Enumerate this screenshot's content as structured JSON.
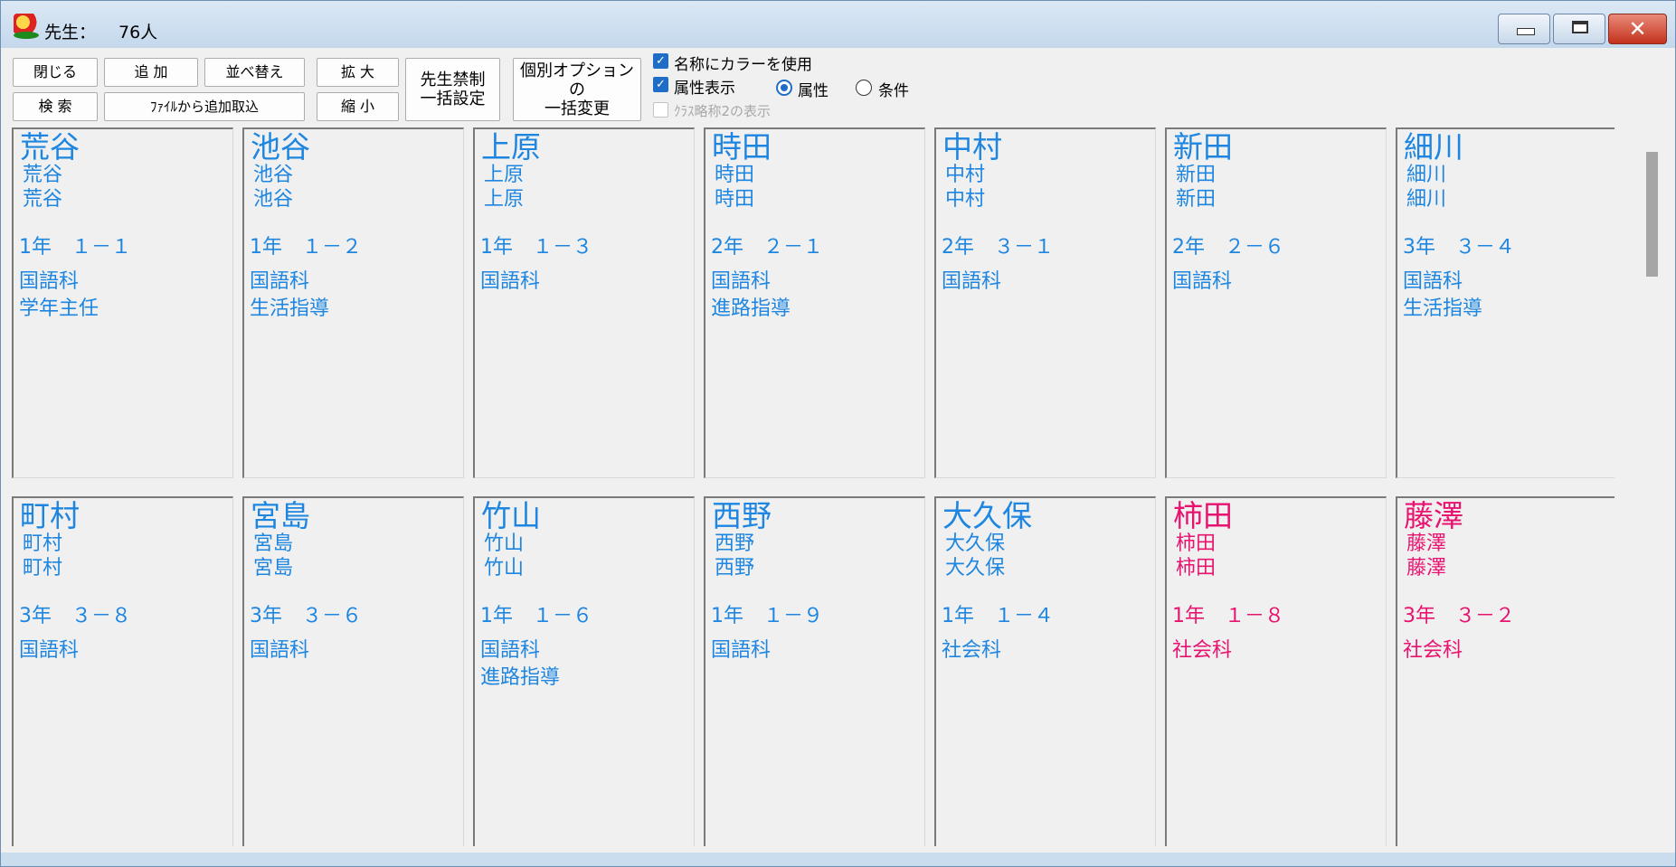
{
  "window": {
    "title_label": "先生：",
    "title_count": "76人",
    "minimize_glyph": "",
    "maximize_glyph": "",
    "close_glyph": "✕"
  },
  "toolbar": {
    "close": "閉じる",
    "add": "追 加",
    "sort": "並べ替え",
    "zoom_in": "拡 大",
    "search": "検 索",
    "import_file": "ﾌｧｲﾙから追加取込",
    "zoom_out": "縮 小",
    "teacher_ban_line1": "先生禁制",
    "teacher_ban_line2": "一括設定",
    "individual_opt_line1": "個別オプションの",
    "individual_opt_line2": "一括変更"
  },
  "options": {
    "use_color_label": "名称にカラーを使用",
    "use_color_checked": true,
    "show_attr_label": "属性表示",
    "show_attr_checked": true,
    "class_abbr_label": "ｸﾗｽ略称2の表示",
    "class_abbr_checked": false,
    "radio_attr_label": "属性",
    "radio_cond_label": "条件",
    "radio_selected": "属性"
  },
  "cards": [
    {
      "name": "荒谷",
      "sub1": "荒谷",
      "sub2": "荒谷",
      "grade": "1年　１－１",
      "attr1": "国語科",
      "attr2": "学年主任",
      "color": "blue"
    },
    {
      "name": "池谷",
      "sub1": "池谷",
      "sub2": "池谷",
      "grade": "1年　１－２",
      "attr1": "国語科",
      "attr2": "生活指導",
      "color": "blue"
    },
    {
      "name": "上原",
      "sub1": "上原",
      "sub2": "上原",
      "grade": "1年　１－３",
      "attr1": "国語科",
      "attr2": "",
      "color": "blue"
    },
    {
      "name": "時田",
      "sub1": "時田",
      "sub2": "時田",
      "grade": "2年　２－１",
      "attr1": "国語科",
      "attr2": "進路指導",
      "color": "blue"
    },
    {
      "name": "中村",
      "sub1": "中村",
      "sub2": "中村",
      "grade": "2年　３－１",
      "attr1": "国語科",
      "attr2": "",
      "color": "blue"
    },
    {
      "name": "新田",
      "sub1": "新田",
      "sub2": "新田",
      "grade": "2年　２－６",
      "attr1": "国語科",
      "attr2": "",
      "color": "blue"
    },
    {
      "name": "細川",
      "sub1": "細川",
      "sub2": "細川",
      "grade": "3年　３－４",
      "attr1": "国語科",
      "attr2": "生活指導",
      "color": "blue"
    },
    {
      "name": "町村",
      "sub1": "町村",
      "sub2": "町村",
      "grade": "3年　３－８",
      "attr1": "国語科",
      "attr2": "",
      "color": "blue"
    },
    {
      "name": "宮島",
      "sub1": "宮島",
      "sub2": "宮島",
      "grade": "3年　３－６",
      "attr1": "国語科",
      "attr2": "",
      "color": "blue"
    },
    {
      "name": "竹山",
      "sub1": "竹山",
      "sub2": "竹山",
      "grade": "1年　１－６",
      "attr1": "国語科",
      "attr2": "進路指導",
      "color": "blue"
    },
    {
      "name": "西野",
      "sub1": "西野",
      "sub2": "西野",
      "grade": "1年　１－９",
      "attr1": "国語科",
      "attr2": "",
      "color": "blue"
    },
    {
      "name": "大久保",
      "sub1": "大久保",
      "sub2": "大久保",
      "grade": "1年　１－４",
      "attr1": "社会科",
      "attr2": "",
      "color": "blue"
    },
    {
      "name": "柿田",
      "sub1": "柿田",
      "sub2": "柿田",
      "grade": "1年　１－８",
      "attr1": "社会科",
      "attr2": "",
      "color": "pink"
    },
    {
      "name": "藤澤",
      "sub1": "藤澤",
      "sub2": "藤澤",
      "grade": "3年　３－２",
      "attr1": "社会科",
      "attr2": "",
      "color": "pink"
    }
  ],
  "colors": {
    "blue": "#1e86e0",
    "pink": "#e8136f"
  }
}
